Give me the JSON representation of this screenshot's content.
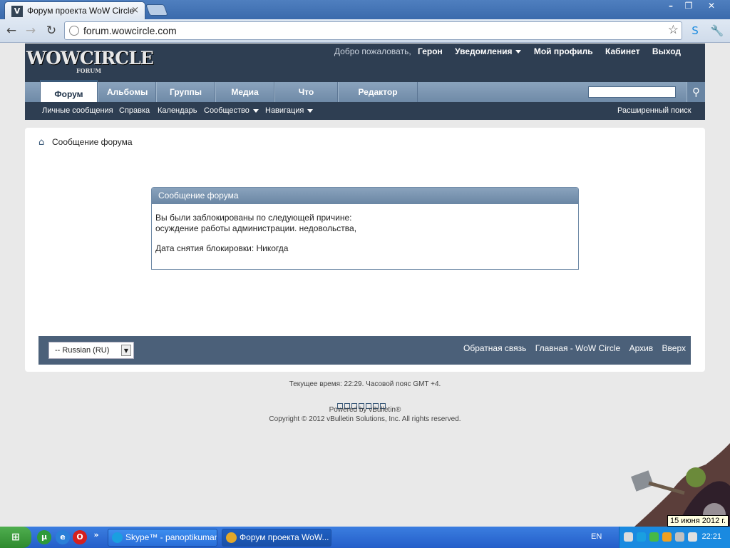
{
  "browser": {
    "tab_title": "Форум проекта WoW Circle",
    "tab_close": "×",
    "url": "forum.wowcircle.com"
  },
  "site": {
    "logo": "WOWCIRCLE",
    "logo_sub": "FORUM",
    "welcome": "Добро пожаловать,",
    "username": "Герон",
    "top_links": [
      "Уведомления",
      "Мой профиль",
      "Кабинет",
      "Выход"
    ],
    "nav_tabs": [
      "Форум",
      "Альбомы",
      "Группы",
      "Медиа",
      "Что нового?",
      "Редактор фото"
    ],
    "sub_nav": [
      "Личные сообщения",
      "Справка",
      "Календарь",
      "Сообщество",
      "Навигация"
    ],
    "advanced_search": "Расширенный поиск"
  },
  "breadcrumb": "Сообщение форума",
  "message": {
    "title": "Сообщение форума",
    "line1": "Вы были заблокированы по следующей причине:",
    "line2": "осуждение работы администрации. недовольства,",
    "line3": "Дата снятия блокировки: Никогда"
  },
  "footer": {
    "language": "-- Russian (RU)",
    "links": [
      "Обратная связь",
      "Главная - WoW Circle",
      "Архив",
      "Вверх"
    ],
    "time_text": "Текущее время: 22:29. Часовой пояс GMT +4.",
    "powered": "Powered by vBulletin®",
    "copyright": "Copyright © 2012 vBulletin Solutions, Inc. All rights reserved."
  },
  "taskbar": {
    "buttons": [
      "Skype™ - panoptikuman",
      "Форум проекта WoW..."
    ],
    "language": "EN",
    "clock": "22:21",
    "date_tooltip": "15 июня 2012 г."
  },
  "colors": {
    "header_bg": "#2e3e52",
    "nav_bg": "#7b96b2",
    "taskbar": "#245ec9"
  }
}
